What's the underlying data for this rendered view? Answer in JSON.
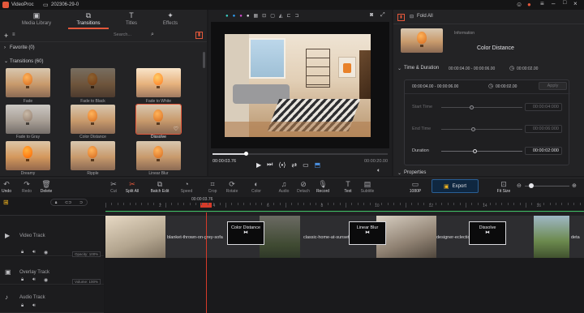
{
  "app": {
    "name": "VideoProc",
    "project": "202306-29-0"
  },
  "left_tabs": [
    {
      "label": "Media Library",
      "icon": "film-icon"
    },
    {
      "label": "Transitions",
      "icon": "transitions-icon"
    },
    {
      "label": "Titles",
      "icon": "titles-icon"
    },
    {
      "label": "Effects",
      "icon": "effects-icon"
    }
  ],
  "search": {
    "placeholder": "Search..."
  },
  "sections": {
    "favorite": "Favorite (0)",
    "transitions": "Transitions (60)"
  },
  "transitions": [
    {
      "label": "Fade"
    },
    {
      "label": "Fade to Black"
    },
    {
      "label": "Fade to White"
    },
    {
      "label": "Fade to Gray"
    },
    {
      "label": "Color Distance"
    },
    {
      "label": "Dissolve"
    },
    {
      "label": "Dreamy"
    },
    {
      "label": "Ripple"
    },
    {
      "label": "Linear Blur"
    }
  ],
  "preview": {
    "current_time": "00:00:03.76",
    "total_time": "00:00:20.00",
    "playhead_fraction": 0.19
  },
  "right": {
    "fold_all": "Fold All",
    "info_label": "Information",
    "info_name": "Color Distance",
    "section_time": "Time & Duration",
    "time_range": "00:00:04.00 - 00:00:06.00",
    "time_duration": "00:00:02.00",
    "inner_range": "00:00:04.00 - 00:00:06.00",
    "inner_duration": "00:00:02.00",
    "apply": "Apply",
    "start_label": "Start Time",
    "start_value": "00:00:04:000",
    "end_label": "End Time",
    "end_value": "00:00:06:000",
    "duration_label": "Duration",
    "duration_value": "00:00:02:000",
    "section_props": "Properties"
  },
  "toolbar": [
    {
      "label": "Undo",
      "icon": "undo-icon",
      "on": true
    },
    {
      "label": "Redo",
      "icon": "redo-icon",
      "on": false
    },
    {
      "label": "Delete",
      "icon": "trash-icon",
      "on": true
    },
    {
      "label": "Cut",
      "icon": "scissors-icon",
      "on": false
    },
    {
      "label": "Split All",
      "icon": "split-icon",
      "on": true
    },
    {
      "label": "Batch Edit",
      "icon": "batch-icon",
      "on": true
    },
    {
      "label": "Speed",
      "icon": "speed-icon",
      "on": false
    },
    {
      "label": "Crop",
      "icon": "crop-icon",
      "on": false
    },
    {
      "label": "Rotate",
      "icon": "rotate-icon",
      "on": false
    },
    {
      "label": "Color",
      "icon": "color-icon",
      "on": false
    },
    {
      "label": "Audio",
      "icon": "audio-icon",
      "on": false
    },
    {
      "label": "Detach",
      "icon": "detach-icon",
      "on": false
    },
    {
      "label": "Record",
      "icon": "mic-icon",
      "on": true
    },
    {
      "label": "Text",
      "icon": "text-icon",
      "on": true
    },
    {
      "label": "Subtitle",
      "icon": "subtitle-icon",
      "on": false
    }
  ],
  "resolution": "1080P",
  "export_label": "Export",
  "fit_label": "Fit Size",
  "timeline": {
    "playhead_time": "00:00:03.76",
    "ruler_labels": [
      "2",
      "4",
      "6",
      "8",
      "10",
      "12",
      "14",
      "16"
    ],
    "tracks": [
      {
        "name": "Video Track",
        "icon": "video-track-icon"
      },
      {
        "name": "Overlay Track",
        "icon": "overlay-track-icon"
      },
      {
        "name": "Audio Track",
        "icon": "audio-track-icon"
      }
    ],
    "opacity": "Opacity: 100%",
    "volume": "Volume: 100%",
    "clips": [
      "blanket-thrown-on-grey-sofa",
      "classic-home-at-sunset",
      "designer-eclectic-living-room",
      "deta"
    ],
    "transitions": [
      "Color Distance",
      "Linear Blur",
      "Dissolve"
    ]
  }
}
